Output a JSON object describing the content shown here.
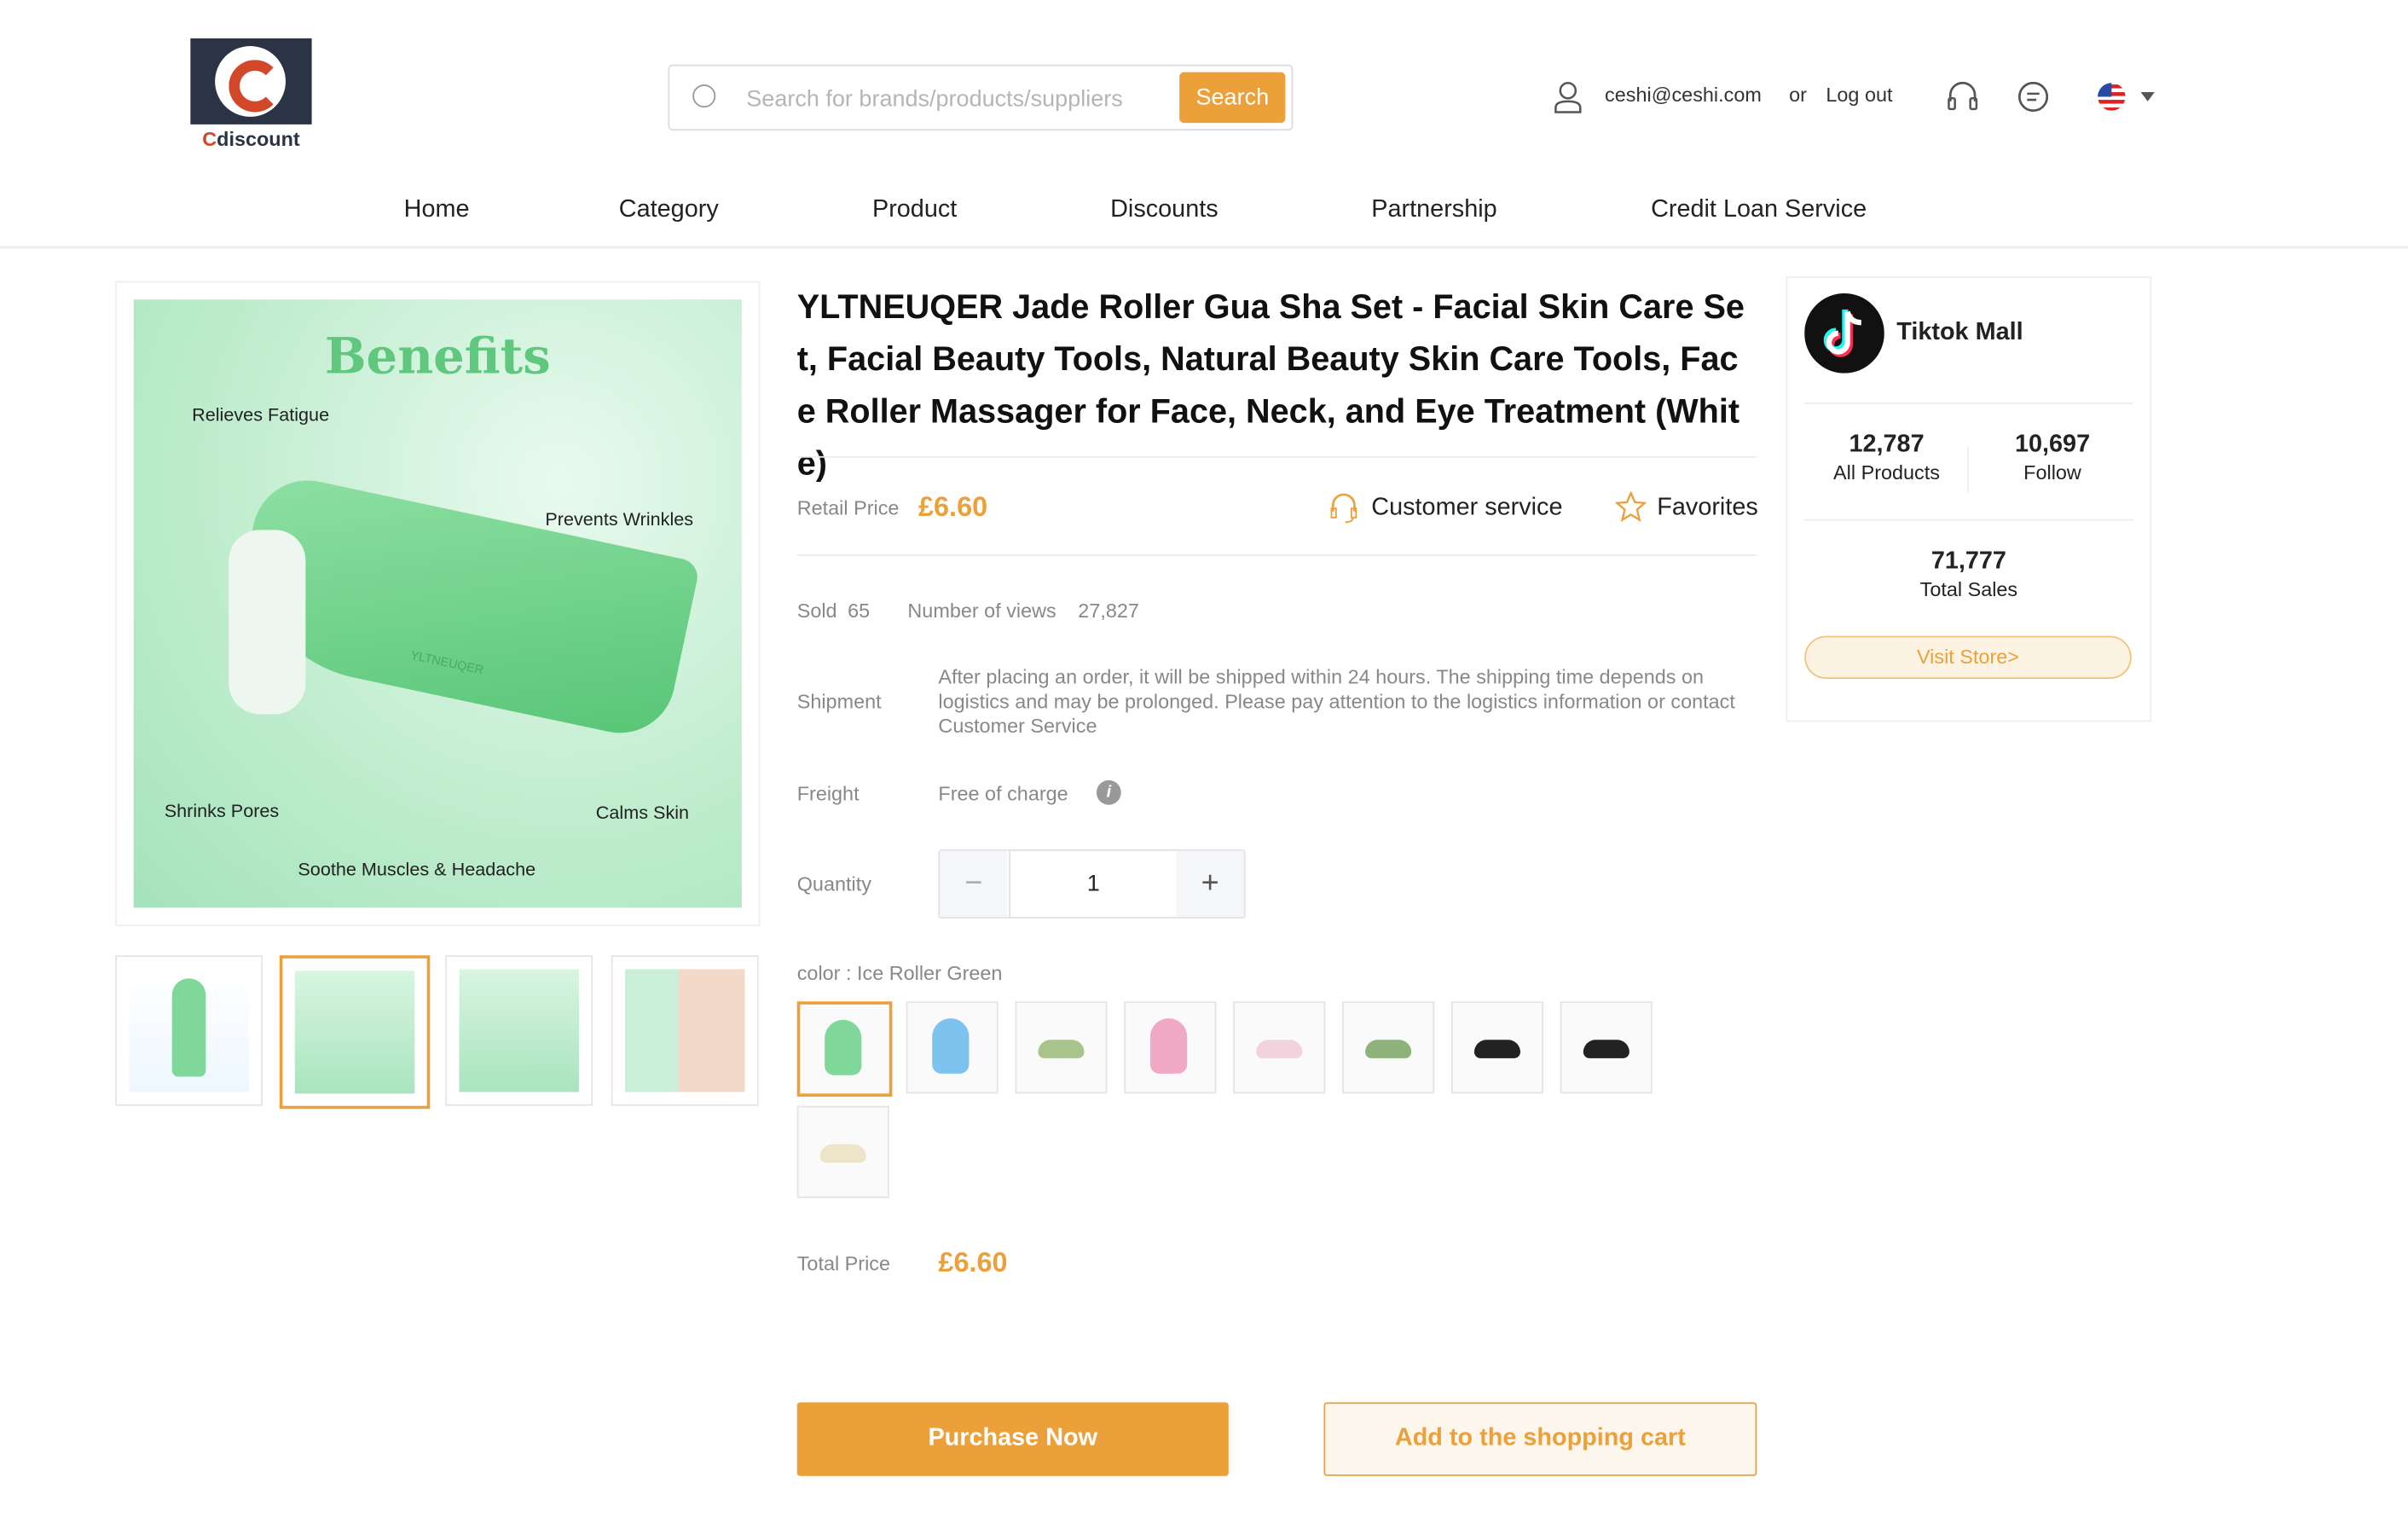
{
  "brand": {
    "logo_text_first": "C",
    "logo_text_rest": "discount"
  },
  "search": {
    "placeholder": "Search for brands/products/suppliers",
    "button": "Search"
  },
  "user": {
    "email": "ceshi@ceshi.com",
    "or": "or",
    "logout": "Log out",
    "language_flag": "us-flag-icon"
  },
  "nav": [
    "Home",
    "Category",
    "Product",
    "Discounts",
    "Partnership",
    "Credit Loan Service"
  ],
  "gallery": {
    "main_labels": {
      "title": "Benefits",
      "l1": "Relieves Fatigue",
      "l2": "Prevents Wrinkles",
      "l3": "Shrinks Pores",
      "l4": "Calms Skin",
      "l5": "Soothe Muscles & Headache",
      "brand": "YLTNEUQER"
    },
    "thumbnails": 4,
    "selected_thumbnail": 2
  },
  "product": {
    "title": "YLTNEUQER Jade Roller Gua Sha Set - Facial Skin Care Set, Facial Beauty Tools, Natural Beauty Skin Care Tools, Face Roller Massager for Face, Neck, and Eye Treatment (White)",
    "retail_label": "Retail Price",
    "retail_price": "£6.60",
    "customer_service": "Customer service",
    "favorites": "Favorites",
    "sold_label": "Sold",
    "sold": "65",
    "views_label": "Number of views",
    "views": "27,827",
    "shipment_label": "Shipment",
    "shipment": "After placing an order, it will be shipped within 24 hours. The shipping time depends on logistics and may be prolonged. Please pay attention to the logistics information or contact Customer Service",
    "freight_label": "Freight",
    "freight": "Free of charge",
    "quantity_label": "Quantity",
    "quantity": "1",
    "minus": "−",
    "plus": "+",
    "color_label": "color : Ice Roller Green",
    "total_label": "Total Price",
    "total": "£6.60",
    "purchase": "Purchase Now",
    "cart": "Add to the shopping cart"
  },
  "store": {
    "name": "Tiktok Mall",
    "products": "12,787",
    "products_label": "All Products",
    "follow": "10,697",
    "follow_label": "Follow",
    "sales": "71,777",
    "sales_label": "Total Sales",
    "visit": "Visit Store>"
  },
  "colors": {
    "accent": "#eba03a",
    "nav_text": "#222222",
    "logo_bg": "#2b3445",
    "logo_red": "#d3482a"
  }
}
